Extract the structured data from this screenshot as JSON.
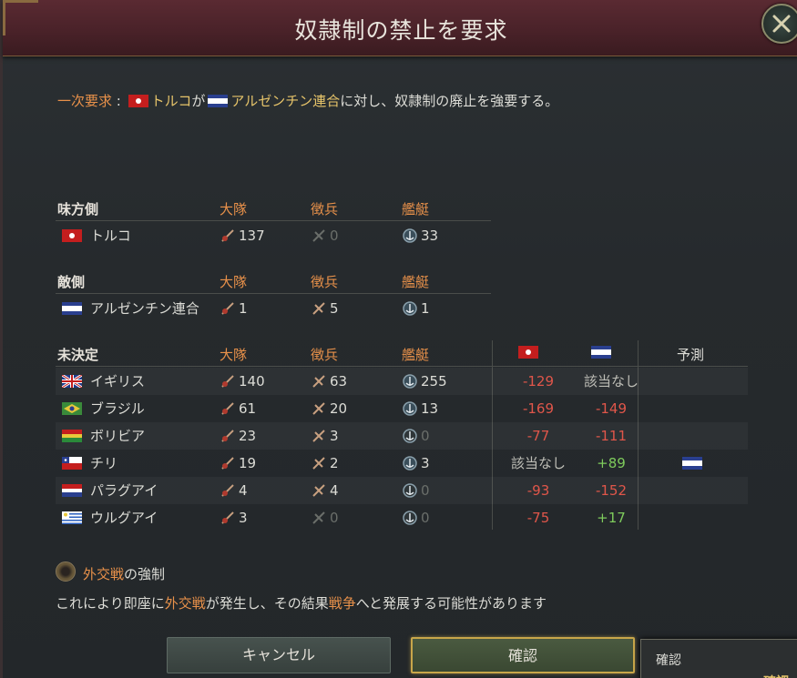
{
  "window": {
    "title": "奴隷制の禁止を要求"
  },
  "primary_demand": {
    "label": "一次要求",
    "separator": ":",
    "actor": "トルコ",
    "particle": "が",
    "target": "アルゼンチン連合",
    "text": "に対し、奴隷制の廃止を強要する。"
  },
  "columns": {
    "battalions": "大隊",
    "conscripts": "徴兵",
    "ships": "艦艇",
    "prediction": "予測"
  },
  "allies": {
    "heading": "味方側",
    "rows": [
      {
        "name": "トルコ",
        "flag": "turkey",
        "battalions": "137",
        "conscripts": "0",
        "ships": "33"
      }
    ]
  },
  "enemies": {
    "heading": "敵側",
    "rows": [
      {
        "name": "アルゼンチン連合",
        "flag": "argentina",
        "battalions": "1",
        "conscripts": "5",
        "ships": "1"
      }
    ]
  },
  "undecided": {
    "heading": "未決定",
    "rows": [
      {
        "name": "イギリス",
        "flag": "uk",
        "battalions": "140",
        "conscripts": "63",
        "ships": "255",
        "turkey": "-129",
        "argentina": "該当なし",
        "prediction": ""
      },
      {
        "name": "ブラジル",
        "flag": "brazil",
        "battalions": "61",
        "conscripts": "20",
        "ships": "13",
        "turkey": "-169",
        "argentina": "-149",
        "prediction": ""
      },
      {
        "name": "ボリビア",
        "flag": "bolivia",
        "battalions": "23",
        "conscripts": "3",
        "ships": "0",
        "turkey": "-77",
        "argentina": "-111",
        "prediction": ""
      },
      {
        "name": "チリ",
        "flag": "chile",
        "battalions": "19",
        "conscripts": "2",
        "ships": "3",
        "turkey": "該当なし",
        "argentina": "+89",
        "prediction": "argentina-flag"
      },
      {
        "name": "パラグアイ",
        "flag": "paraguay",
        "battalions": "4",
        "conscripts": "4",
        "ships": "0",
        "turkey": "-93",
        "argentina": "-152",
        "prediction": ""
      },
      {
        "name": "ウルグアイ",
        "flag": "uruguay",
        "battalions": "3",
        "conscripts": "0",
        "ships": "0",
        "turkey": "-75",
        "argentina": "+17",
        "prediction": ""
      }
    ]
  },
  "force_option": {
    "word": "外交戦",
    "suffix": "の強制"
  },
  "description": {
    "part1": "これにより即座に",
    "word1": "外交戦",
    "part2": "が発生し、その結果",
    "word2": "戦争",
    "part3": "へと発展する可能性があります"
  },
  "buttons": {
    "cancel": "キャンセル",
    "confirm": "確認"
  },
  "tooltip": {
    "title": "確認",
    "extra": "確認"
  },
  "icons": {
    "battalion": "soldier-icon",
    "conscript": "conscript-icon",
    "ship": "anchor-icon",
    "close": "close-icon"
  },
  "colors": {
    "accent_orange": "#e8914a",
    "negative": "#e0564a",
    "positive": "#7ecb5c",
    "gold": "#c8a64a"
  }
}
